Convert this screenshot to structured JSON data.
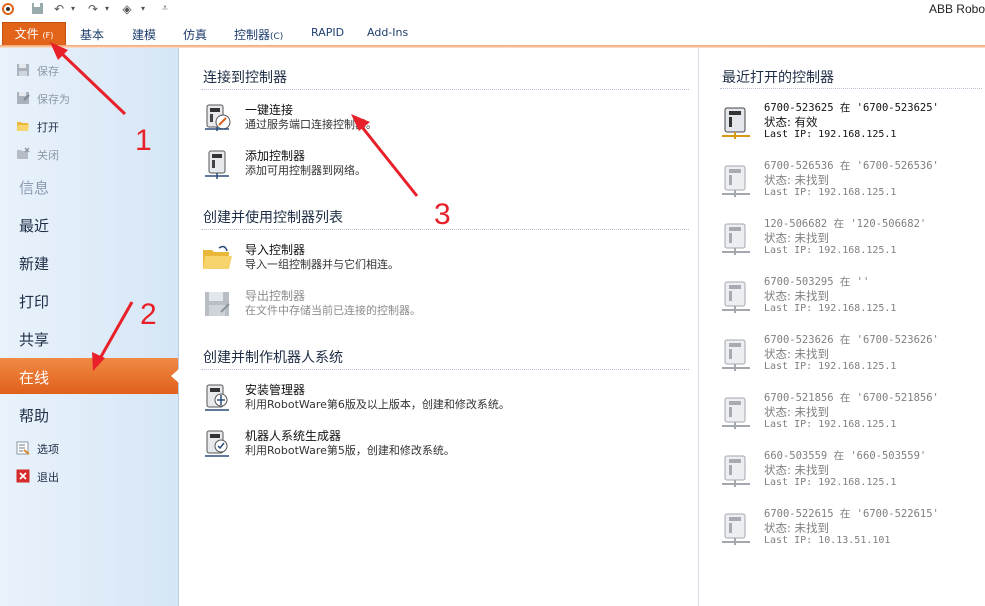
{
  "app": {
    "title": "ABB Robo"
  },
  "ribbon": {
    "file_tab": {
      "label": "文件",
      "key": "(F)"
    },
    "tabs": [
      {
        "label": "基本"
      },
      {
        "label": "建模"
      },
      {
        "label": "仿真"
      },
      {
        "label": "控制器",
        "key": "(C)"
      },
      {
        "label": "RAPID"
      },
      {
        "label": "Add-Ins"
      }
    ]
  },
  "sidebar": {
    "small_top": [
      {
        "label": "保存",
        "icon": "save-icon",
        "disabled": true
      },
      {
        "label": "保存为",
        "icon": "save-as-icon",
        "disabled": true
      },
      {
        "label": "打开",
        "icon": "open-folder-icon",
        "disabled": false
      },
      {
        "label": "关闭",
        "icon": "close-folder-icon",
        "disabled": true
      }
    ],
    "big": [
      {
        "label": "信息",
        "disabled": true
      },
      {
        "label": "最近"
      },
      {
        "label": "新建"
      },
      {
        "label": "打印"
      },
      {
        "label": "共享"
      },
      {
        "label": "在线",
        "active": true
      },
      {
        "label": "帮助"
      }
    ],
    "small_bottom": [
      {
        "label": "选项",
        "icon": "options-icon"
      },
      {
        "label": "退出",
        "icon": "exit-icon"
      }
    ]
  },
  "main": {
    "sections": [
      {
        "title": "连接到控制器",
        "actions": [
          {
            "title": "一键连接",
            "desc": "通过服务端口连接控制器。",
            "icon": "one-click-connect-icon"
          },
          {
            "title": "添加控制器",
            "desc": "添加可用控制器到网络。",
            "icon": "add-controller-icon"
          }
        ]
      },
      {
        "title": "创建并使用控制器列表",
        "actions": [
          {
            "title": "导入控制器",
            "desc": "导入一组控制器并与它们相连。",
            "icon": "import-folder-icon"
          },
          {
            "title": "导出控制器",
            "desc": "在文件中存储当前已连接的控制器。",
            "icon": "export-controller-icon",
            "disabled": true
          }
        ]
      },
      {
        "title": "创建并制作机器人系统",
        "actions": [
          {
            "title": "安装管理器",
            "desc": "利用RobotWare第6版及以上版本，创建和修改系统。",
            "icon": "installation-manager-icon"
          },
          {
            "title": "机器人系统生成器",
            "desc": "利用RobotWare第5版，创建和修改系统。",
            "icon": "system-builder-icon"
          }
        ]
      }
    ]
  },
  "recent": {
    "title": "最近打开的控制器",
    "items": [
      {
        "name": "6700-523625 在 '6700-523625'",
        "status": "状态: 有效",
        "ip": "Last IP: 192.168.125.1",
        "online": true
      },
      {
        "name": "6700-526536 在 '6700-526536'",
        "status": "状态: 未找到",
        "ip": "Last IP: 192.168.125.1",
        "online": false
      },
      {
        "name": "120-506682 在 '120-506682'",
        "status": "状态: 未找到",
        "ip": "Last IP: 192.168.125.1",
        "online": false
      },
      {
        "name": "6700-503295 在 ''",
        "status": "状态: 未找到",
        "ip": "Last IP: 192.168.125.1",
        "online": false
      },
      {
        "name": "6700-523626 在 '6700-523626'",
        "status": "状态: 未找到",
        "ip": "Last IP: 192.168.125.1",
        "online": false
      },
      {
        "name": "6700-521856 在 '6700-521856'",
        "status": "状态: 未找到",
        "ip": "Last IP: 192.168.125.1",
        "online": false
      },
      {
        "name": "660-503559 在 '660-503559'",
        "status": "状态: 未找到",
        "ip": "Last IP: 192.168.125.1",
        "online": false
      },
      {
        "name": "6700-522615 在 '6700-522615'",
        "status": "状态: 未找到",
        "ip": "Last IP: 10.13.51.101",
        "online": false
      }
    ]
  },
  "annotations": {
    "labels": [
      "1",
      "2",
      "3"
    ],
    "color": "#e8202a"
  },
  "colors": {
    "accent": "#e2641b",
    "sidebar": "#dceaf7"
  }
}
